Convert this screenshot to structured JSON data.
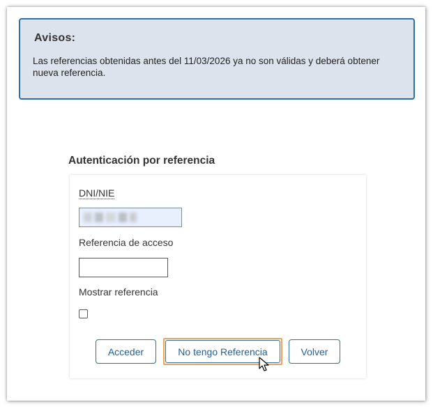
{
  "notice": {
    "title": "Avisos:",
    "text": "Las referencias obtenidas antes del 11/03/2026 ya no son válidas y deberá obtener nueva referencia."
  },
  "auth": {
    "title": "Autenticación por referencia",
    "dni_label": "DNI/NIE",
    "dni_value": "",
    "ref_label": "Referencia de acceso",
    "ref_value": "",
    "show_label": "Mostrar referencia",
    "show_checked": false
  },
  "buttons": {
    "acceder": "Acceder",
    "no_ref": "No tengo Referencia",
    "volver": "Volver"
  },
  "colors": {
    "accent": "#2f6ea8",
    "notice_bg": "#dce3ec",
    "focus_ring": "#f0a35a",
    "autofill_bg": "#e8f0fe"
  },
  "icons": {
    "cursor": "mouse-pointer-icon"
  }
}
